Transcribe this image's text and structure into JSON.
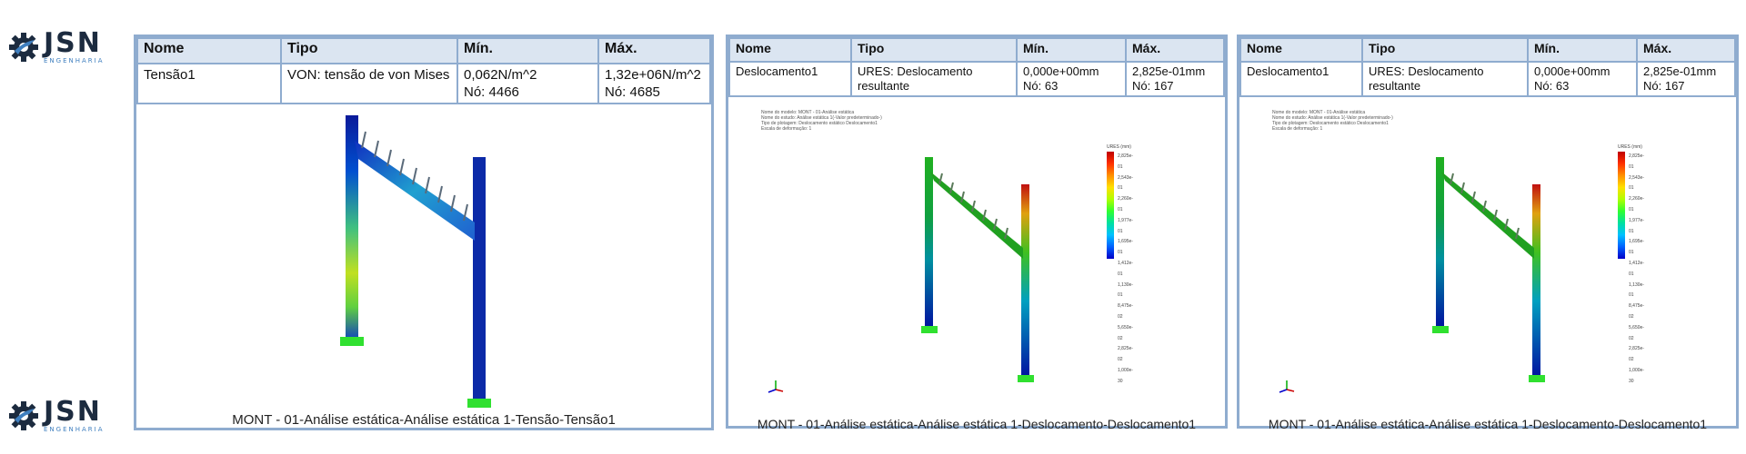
{
  "logo": {
    "name": "JSN",
    "subtitle": "ENGENHARIA",
    "icon": "gear-icon"
  },
  "panels": [
    {
      "columns": [
        "Nome",
        "Tipo",
        "Mín.",
        "Máx."
      ],
      "row": {
        "nome": "Tensão1",
        "tipo": "VON: tensão de von Mises",
        "min_value": "0,062N/m^2",
        "min_node": "Nó: 4466",
        "max_value": "1,32e+06N/m^2",
        "max_node": "Nó: 4685"
      },
      "caption": "MONT - 01-Análise estática-Análise estática 1-Tensão-Tensão1"
    },
    {
      "columns": [
        "Nome",
        "Tipo",
        "Mín.",
        "Máx."
      ],
      "row": {
        "nome": "Deslocamento1",
        "tipo": "URES:  Deslocamento resultante",
        "min_value": "0,000e+00mm",
        "min_node": "Nó: 63",
        "max_value": "2,825e-01mm",
        "max_node": "Nó: 167"
      },
      "caption": "MONT - 01-Análise estática-Análise estática 1-Deslocamento-Deslocamento1"
    },
    {
      "columns": [
        "Nome",
        "Tipo",
        "Mín.",
        "Máx."
      ],
      "row": {
        "nome": "Deslocamento1",
        "tipo": "URES:  Deslocamento resultante",
        "min_value": "0,000e+00mm",
        "min_node": "Nó: 63",
        "max_value": "2,825e-01mm",
        "max_node": "Nó: 167"
      },
      "caption": "MONT - 01-Análise estática-Análise estática 1-Deslocamento-Deslocamento1"
    }
  ],
  "plot_header_lines": [
    "Nome do modelo: MONT - 01-Análise estática",
    "Nome do estudo: Análise estática 1(-Valor predeterminado-)",
    "Tipo de plotagem: Deslocamento estático Deslocamento1",
    "Escala de deformação: 1"
  ],
  "legend": {
    "title": "URES (mm)",
    "ticks": [
      "2,825e-01",
      "2,543e-01",
      "2,260e-01",
      "1,977e-01",
      "1,695e-01",
      "1,412e-01",
      "1,130e-01",
      "8,475e-02",
      "5,650e-02",
      "2,825e-02",
      "1,000e-30"
    ]
  },
  "colors": {
    "table_border": "#8faccf",
    "header_fill": "#dbe5f1",
    "logo_dark": "#1c2b3f",
    "logo_accent": "#3f7fbf"
  }
}
